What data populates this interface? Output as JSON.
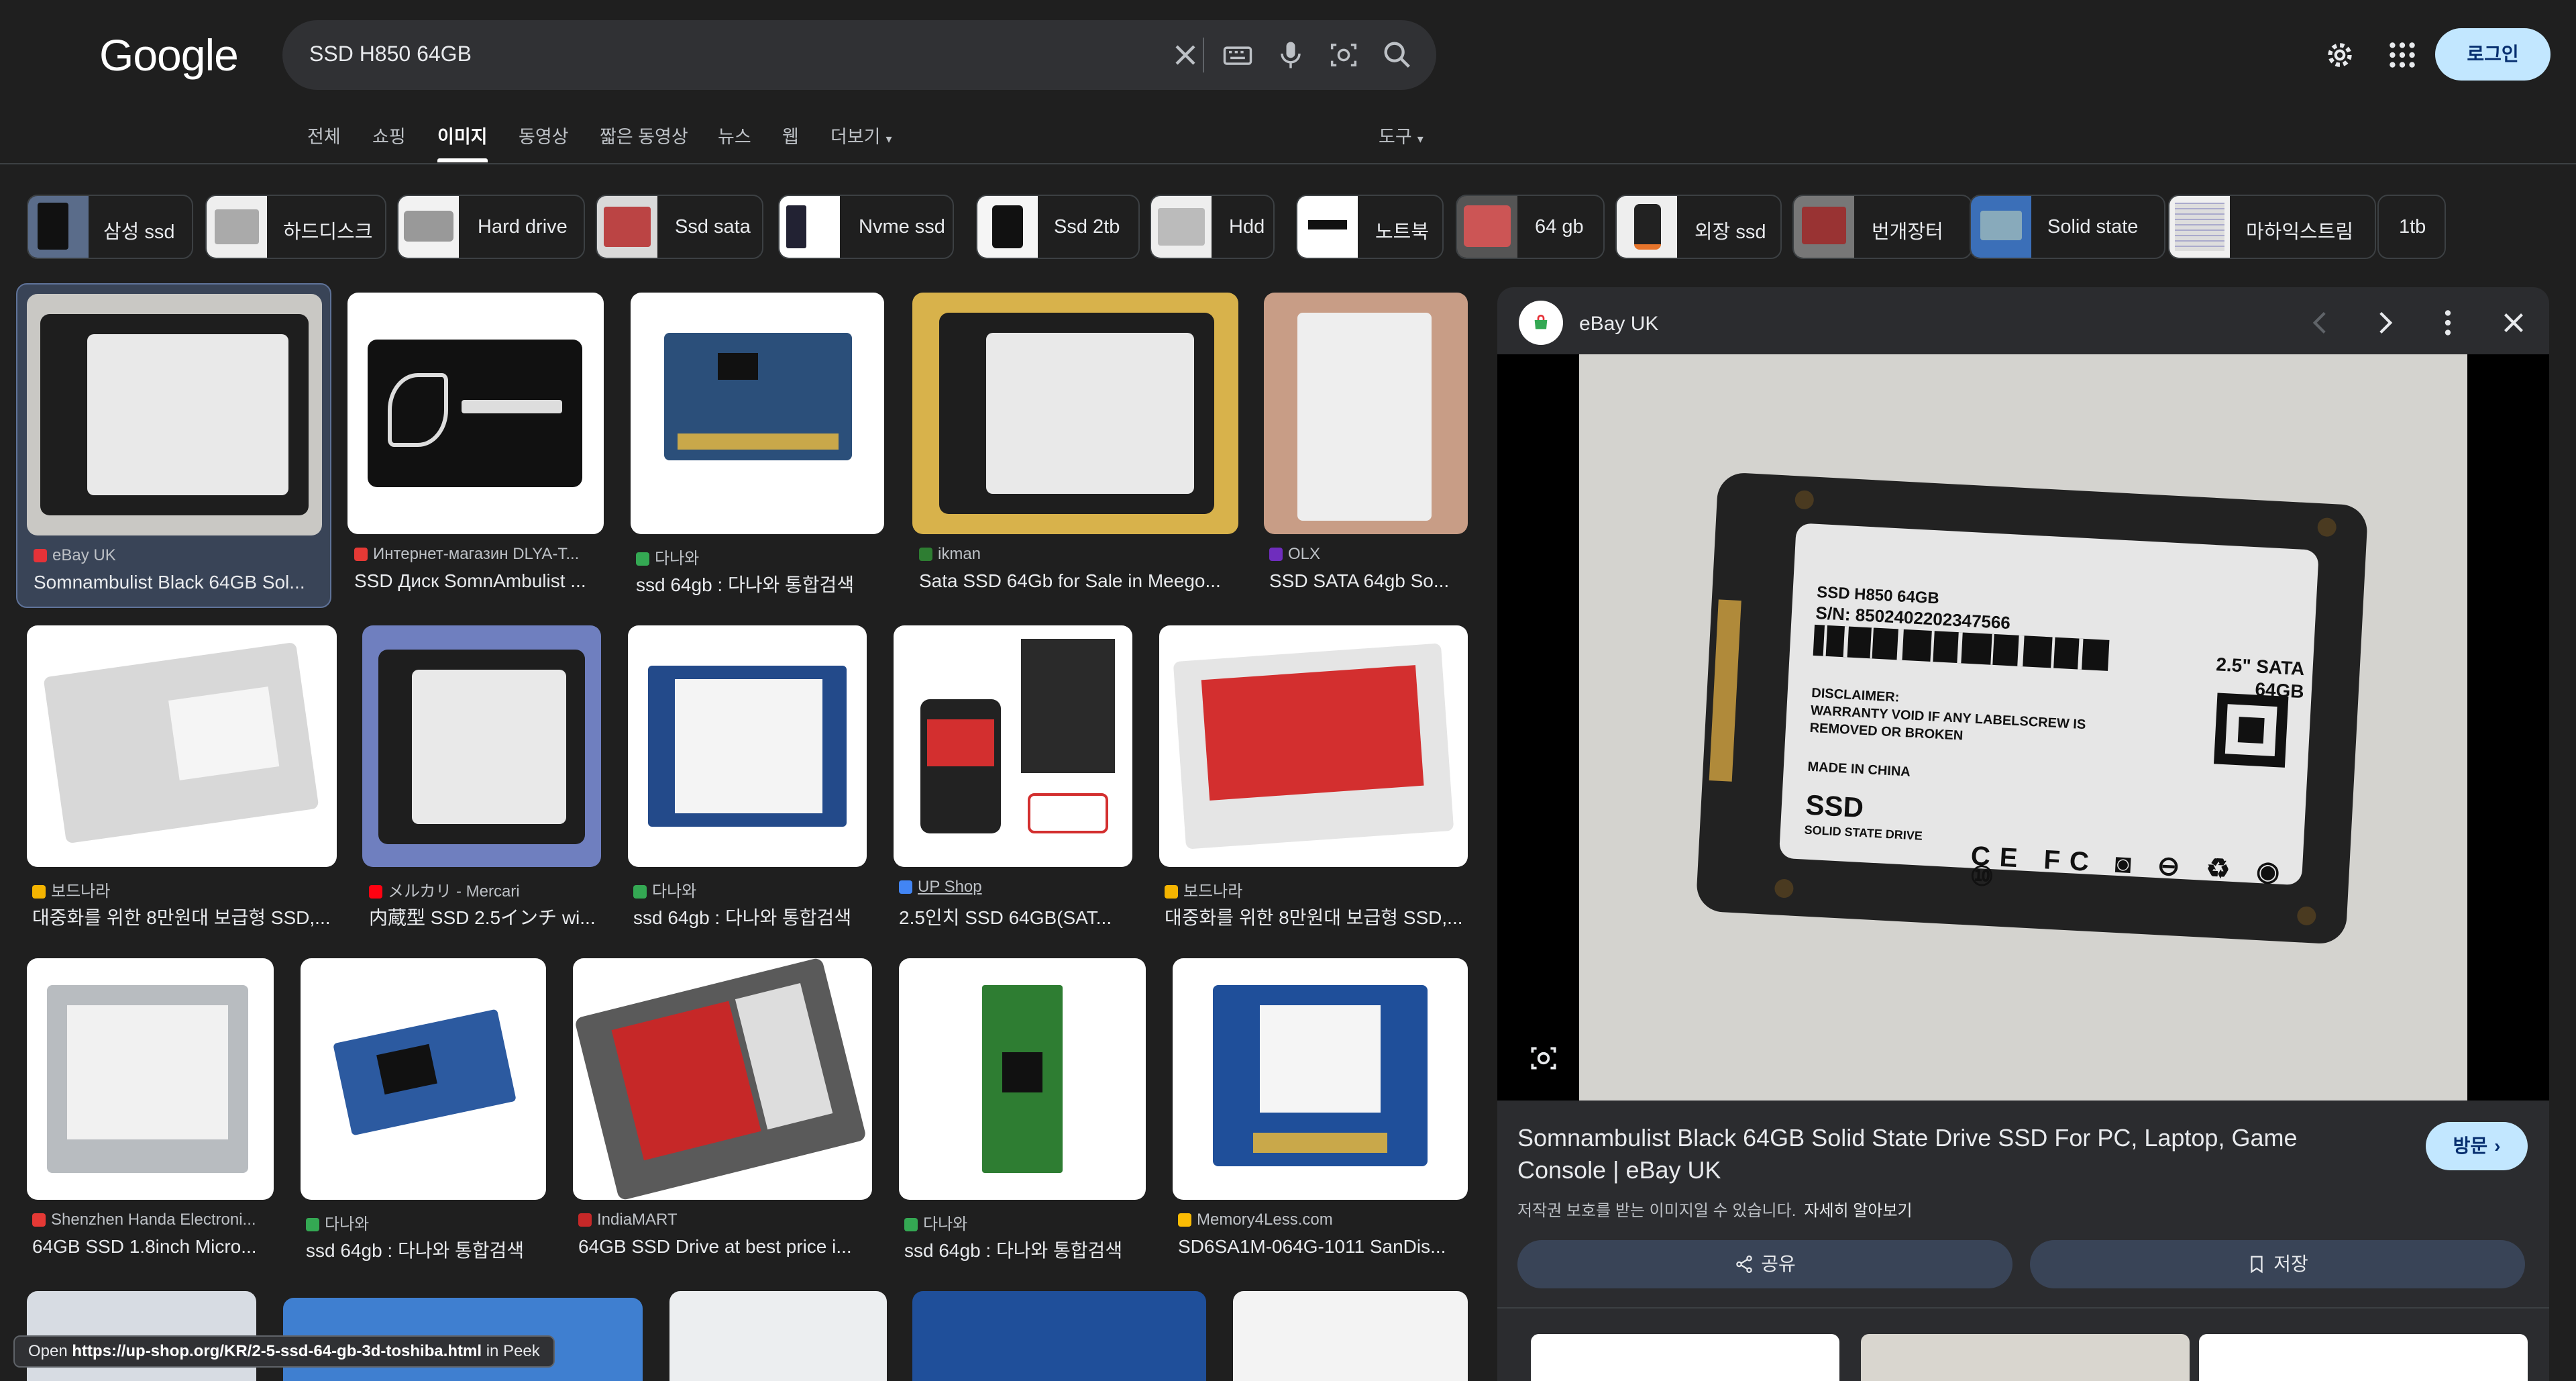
{
  "header": {
    "logo": "Google",
    "search_value": "SSD H850 64GB",
    "login_label": "로그인"
  },
  "tabs": [
    "전체",
    "쇼핑",
    "이미지",
    "동영상",
    "짧은 동영상",
    "뉴스",
    "웹",
    "더보기"
  ],
  "tools_label": "도구",
  "chips": [
    "삼성 ssd",
    "하드디스크",
    "Hard drive",
    "Ssd sata",
    "Nvme ssd",
    "Ssd 2tb",
    "Hdd",
    "노트북",
    "64 gb",
    "외장 ssd",
    "번개장터",
    "Solid state",
    "마하익스트림",
    "1tb"
  ],
  "results": [
    {
      "source": "eBay UK",
      "title": "Somnambulist Black 64GB Sol..."
    },
    {
      "source": "Интернет-магазин DLYA-T...",
      "title": "SSD Диск SomnAmbulist ..."
    },
    {
      "source": "다나와",
      "title": "ssd 64gb : 다나와 통합검색"
    },
    {
      "source": "ikman",
      "title": "Sata SSD 64Gb for Sale in Meego..."
    },
    {
      "source": "OLX",
      "title": "SSD SATA 64gb So..."
    },
    {
      "source": "보드나라",
      "title": "대중화를 위한 8만원대 보급형 SSD,..."
    },
    {
      "source": "メルカリ - Mercari",
      "title": "内蔵型 SSD 2.5インチ wi..."
    },
    {
      "source": "다나와",
      "title": "ssd 64gb : 다나와 통합검색"
    },
    {
      "source": "UP Shop",
      "title": "2.5인치 SSD 64GB(SAT..."
    },
    {
      "source": "보드나라",
      "title": "대중화를 위한 8만원대 보급형 SSD,..."
    },
    {
      "source": "Shenzhen Handa Electroni...",
      "title": "64GB SSD 1.8inch Micro..."
    },
    {
      "source": "다나와",
      "title": "ssd 64gb : 다나와 통합검색"
    },
    {
      "source": "IndiaMART",
      "title": "64GB SSD Drive at best price i..."
    },
    {
      "source": "다나와",
      "title": "ssd 64gb : 다나와 통합검색"
    },
    {
      "source": "Memory4Less.com",
      "title": "SD6SA1M-064G-1011 SanDis..."
    }
  ],
  "panel": {
    "source_name": "eBay UK",
    "title": "Somnambulist Black 64GB Solid State Drive SSD For PC, Laptop, Game Console | eBay UK",
    "visit_label": "방문",
    "copyright_note": "저작권 보호를 받는 이미지일 수 있습니다.",
    "learn_more": "자세히 알아보기",
    "share_label": "공유",
    "save_label": "저장",
    "photo_label": {
      "line1": "SSD  H850   64GB",
      "serial": "S/N: 8502402202347566",
      "sata": "2.5\" SATA",
      "cap": "64GB",
      "disclaimer": "DISCLAIMER:",
      "warranty": "WARRANTY VOID IF ANY LABELSCREW IS",
      "removed": "REMOVED OR BROKEN",
      "made": "MADE IN CHINA",
      "ssd": "SSD",
      "ssd_sub": "SOLID STATE DRIVE"
    }
  },
  "status_bar": {
    "open": "Open",
    "url": "https://up-shop.org/KR/2-5-ssd-64-gb-3d-toshiba.html",
    "suffix": "in Peek"
  },
  "colors": {
    "background": "#1f1f1f",
    "accent": "#c2e7ff",
    "selected": "#394457"
  }
}
